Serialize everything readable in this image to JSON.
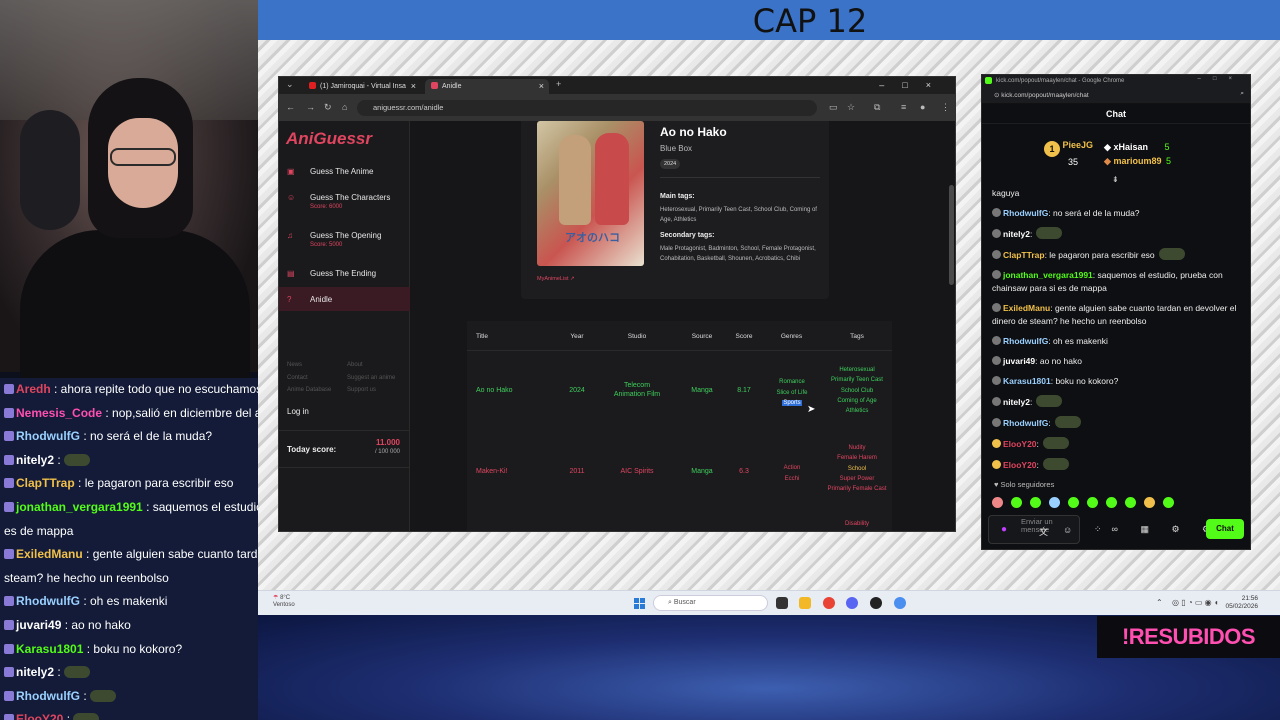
{
  "stream": {
    "cap_title": "CAP 12",
    "resubidos": "!RESUBIDOS"
  },
  "left_chat": [
    {
      "user": "Aredh",
      "text": " : ahora repite todo que no escuchamos",
      "color": "#e0455f"
    },
    {
      "user": "Nemesis_Code",
      "text": " : nop,salió en diciembre del año",
      "color": "#ff4fb0"
    },
    {
      "user": "RhodwulfG",
      "text": " : no será el de la muda?",
      "color": "#9ad0ff"
    },
    {
      "user": "nitely2",
      "text": " : ",
      "color": "#ffffff",
      "emote": true
    },
    {
      "user": "ClapTTrap",
      "text": " : le pagaron para escribir eso",
      "color": "#f0c04a"
    },
    {
      "user": "jonathan_vergara1991",
      "text": " : saquemos el estudio,",
      "color": "#53fc18"
    },
    {
      "user": "",
      "text": "es de mappa",
      "color": "#ffffff"
    },
    {
      "user": "ExiledManu",
      "text": " : gente alguien sabe cuanto tardan",
      "color": "#f0c04a"
    },
    {
      "user": "",
      "text": "steam? he hecho un reenbolso",
      "color": "#ffffff"
    },
    {
      "user": "RhodwulfG",
      "text": " : oh es makenki",
      "color": "#9ad0ff"
    },
    {
      "user": "juvari49",
      "text": " : ao no hako",
      "color": "#ffffff"
    },
    {
      "user": "Karasu1801",
      "text": " : boku no kokoro?",
      "color": "#53fc18"
    },
    {
      "user": "nitely2",
      "text": " : ",
      "color": "#ffffff",
      "emote": true
    },
    {
      "user": "RhodwulfG",
      "text": " : ",
      "color": "#9ad0ff",
      "emote": true
    },
    {
      "user": "ElooY20",
      "text": " : ",
      "color": "#e0455f",
      "emote": true
    },
    {
      "user": "ElooY20",
      "text": " : ",
      "color": "#e0455f",
      "emote": true
    }
  ],
  "browser": {
    "tab1": "(1) Jamiroquai - Virtual Insa",
    "tab2": "Anidle",
    "url": "aniguessr.com/anidle"
  },
  "site": {
    "logo": "AniGuessr",
    "menu": [
      {
        "label": "Guess The Anime",
        "score": ""
      },
      {
        "label": "Guess The Characters",
        "score": "Score: 6000"
      },
      {
        "label": "Guess The Opening",
        "score": "Score: 5000"
      },
      {
        "label": "Guess The Ending",
        "score": ""
      },
      {
        "label": "Anidle",
        "score": ""
      }
    ],
    "links": [
      "News",
      "About",
      "Contact",
      "Suggest an anime",
      "Anime Database",
      "Support us"
    ],
    "login": "Log in",
    "today_score_label": "Today score:",
    "today_score": "11.000",
    "today_score_max": "/ 100 000"
  },
  "detail": {
    "title": "Ao no Hako",
    "alt_title": "Blue Box",
    "year": "2024",
    "cover_text": "アオのハコ",
    "mal_link": "MyAnimeList",
    "main_tags_label": "Main tags:",
    "main_tags": "Heterosexual, Primarily Teen Cast, School Club, Coming of Age, Athletics",
    "secondary_tags_label": "Secondary tags:",
    "secondary_tags": "Male Protagonist, Badminton, School, Female Protagonist, Cohabitation, Basketball, Shounen, Acrobatics, Chibi"
  },
  "results": {
    "headers": [
      "Title",
      "Year",
      "Studio",
      "Source",
      "Score",
      "Genres",
      "Tags"
    ],
    "rows": [
      {
        "title": "Ao no Hako",
        "year": "2024",
        "studio": "Telecom Animation Film",
        "source": "Manga",
        "score": "8.17",
        "genres": [
          "Romance",
          "Slice of Life",
          "Sports"
        ],
        "tags": [
          "Heterosexual",
          "Primarily Teen Cast",
          "School Club",
          "Coming of Age",
          "Athletics"
        ]
      },
      {
        "title": "Maken-Ki!",
        "year": "2011",
        "studio": "AIC Spirits",
        "source": "Manga",
        "score": "6.3",
        "genres": [
          "Action",
          "Ecchi"
        ],
        "tags": [
          "Nudity",
          "Female Harem",
          "School",
          "Super Power",
          "Primarily Female Cast"
        ]
      }
    ],
    "next_tag": "Disability"
  },
  "taskbar": {
    "weather_temp": "8°C",
    "weather_desc": "Ventoso",
    "search": "Buscar",
    "time": "21:56",
    "date": "05/02/2026"
  },
  "chat_window": {
    "title": "kick.com/popout/maaylen/chat - Google Chrome",
    "url": "kick.com/popout/maaylen/chat",
    "header": "Chat",
    "leaders": [
      {
        "name": "PieeJG",
        "count": "35"
      },
      {
        "name": "xHaisan",
        "count": "5"
      },
      {
        "name": "marioum89",
        "count": "5"
      }
    ],
    "messages": [
      {
        "user": "",
        "text": "kaguya",
        "color": "#ffffff"
      },
      {
        "user": "RhodwulfG",
        "text": ": no será el de la muda?",
        "color": "#9ad0ff"
      },
      {
        "user": "nitely2",
        "text": ":",
        "color": "#ffffff",
        "emote": true
      },
      {
        "user": "ClapTTrap",
        "text": ": le pagaron para escribir eso",
        "color": "#f0c04a",
        "emote": true
      },
      {
        "user": "jonathan_vergara1991",
        "text": ": saquemos el estudio, prueba con chainsaw para si es de mappa",
        "color": "#53fc18"
      },
      {
        "user": "ExiledManu",
        "text": ": gente alguien sabe cuanto tardan en devolver el dinero de steam? he hecho un reenbolso",
        "color": "#f0c04a"
      },
      {
        "user": "RhodwulfG",
        "text": ": oh es makenki",
        "color": "#9ad0ff"
      },
      {
        "user": "juvari49",
        "text": ": ao no hako",
        "color": "#ffffff"
      },
      {
        "user": "Karasu1801",
        "text": ": boku no kokoro?",
        "color": "#9ad0ff"
      },
      {
        "user": "nitely2",
        "text": ":",
        "color": "#ffffff",
        "emote": true
      },
      {
        "user": "RhodwulfG",
        "text": ":",
        "color": "#9ad0ff",
        "emote": true
      },
      {
        "user": "ElooY20",
        "text": ":",
        "color": "#e0455f",
        "emote": true
      },
      {
        "user": "ElooY20",
        "text": ":",
        "color": "#e0455f",
        "emote": true
      }
    ],
    "followers": "Solo seguidores",
    "placeholder": "Enviar un mensaje",
    "send": "Chat"
  }
}
